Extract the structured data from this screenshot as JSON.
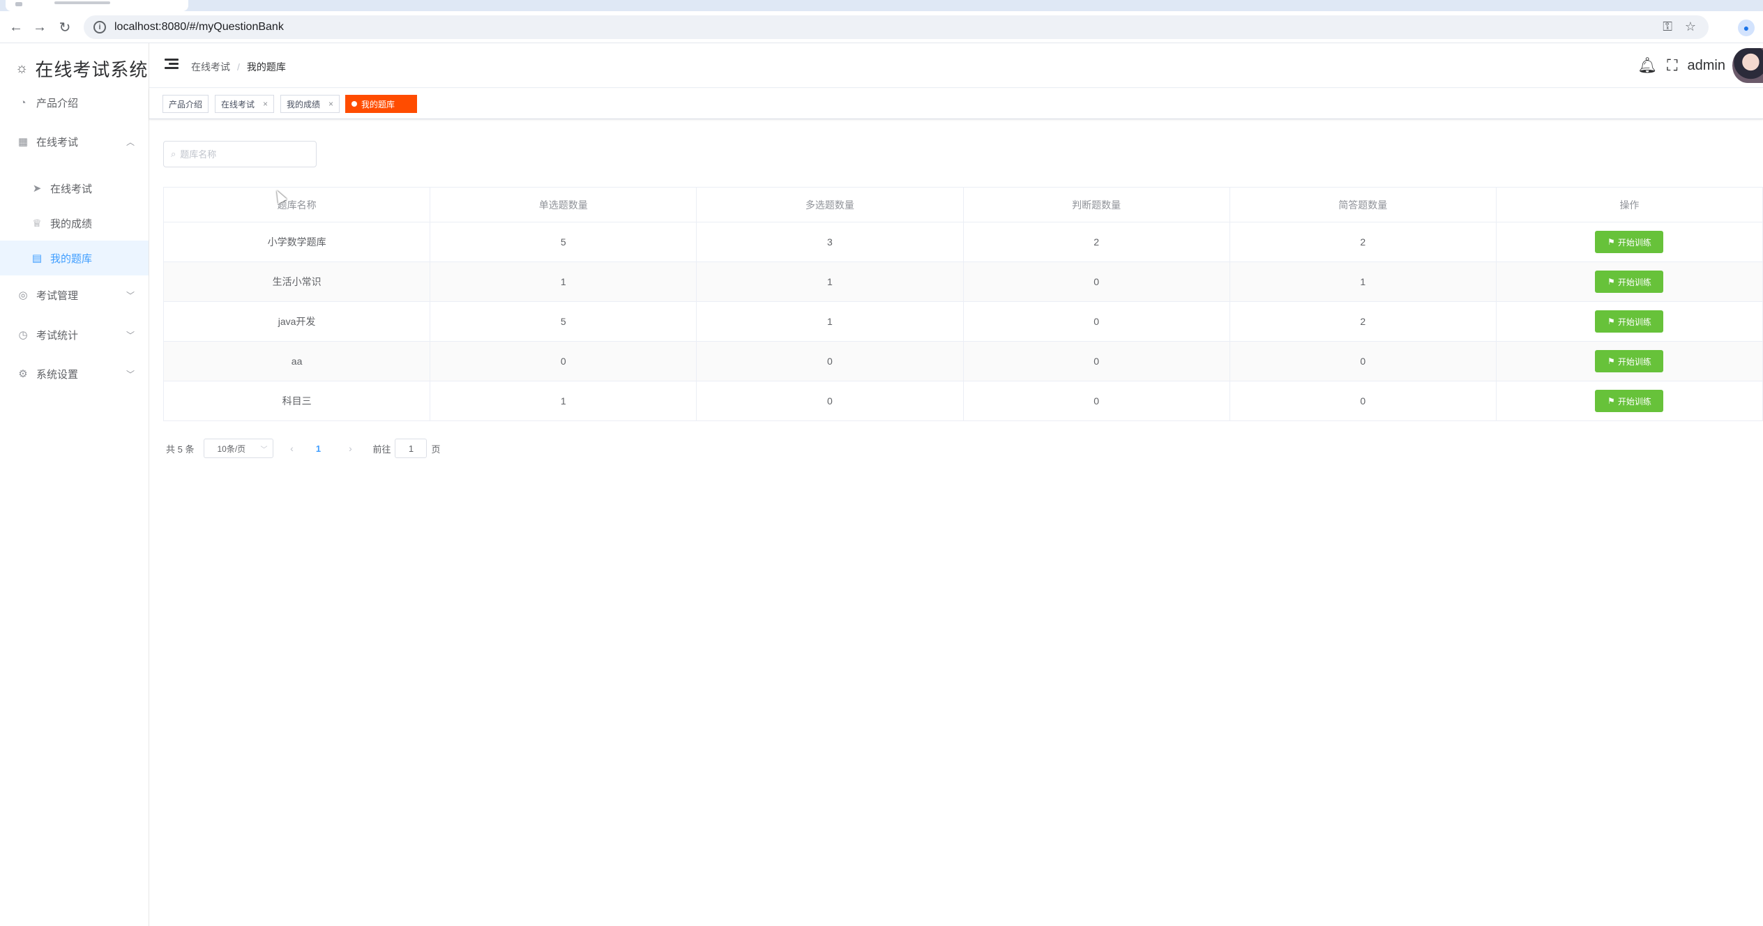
{
  "browser": {
    "url": "localhost:8080/#/myQuestionBank"
  },
  "sidebar": {
    "title": "在线考试系统",
    "items": [
      {
        "label": "产品介绍"
      },
      {
        "label": "在线考试"
      },
      {
        "label": "在线考试"
      },
      {
        "label": "我的成绩"
      },
      {
        "label": "我的题库"
      },
      {
        "label": "考试管理"
      },
      {
        "label": "考试统计"
      },
      {
        "label": "系统设置"
      }
    ]
  },
  "header": {
    "breadcrumb": [
      "在线考试",
      "我的题库"
    ],
    "breadcrumb_sep": "/",
    "username": "admin"
  },
  "tags": [
    {
      "label": "产品介绍"
    },
    {
      "label": "在线考试",
      "close": "×"
    },
    {
      "label": "我的成绩",
      "close": "×"
    },
    {
      "label": "我的题库"
    }
  ],
  "search": {
    "placeholder": "题库名称"
  },
  "table": {
    "columns": [
      "题库名称",
      "单选题数量",
      "多选题数量",
      "判断题数量",
      "简答题数量",
      "操作"
    ],
    "rows": [
      [
        "小学数学题库",
        "5",
        "3",
        "2",
        "2"
      ],
      [
        "生活小常识",
        "1",
        "1",
        "0",
        "1"
      ],
      [
        "java开发",
        "5",
        "1",
        "0",
        "2"
      ],
      [
        "aa",
        "0",
        "0",
        "0",
        "0"
      ],
      [
        "科目三",
        "1",
        "0",
        "0",
        "0"
      ]
    ],
    "action_label": "开始训练"
  },
  "pagination": {
    "total": "共 5 条",
    "page_size": "10条/页",
    "current_page": "1",
    "goto_prefix": "前往",
    "goto_value": "1",
    "goto_suffix": "页"
  },
  "colors": {
    "active_tag": "#ff4c00",
    "action_button": "#67c23a",
    "menu_active": "#409eff"
  }
}
